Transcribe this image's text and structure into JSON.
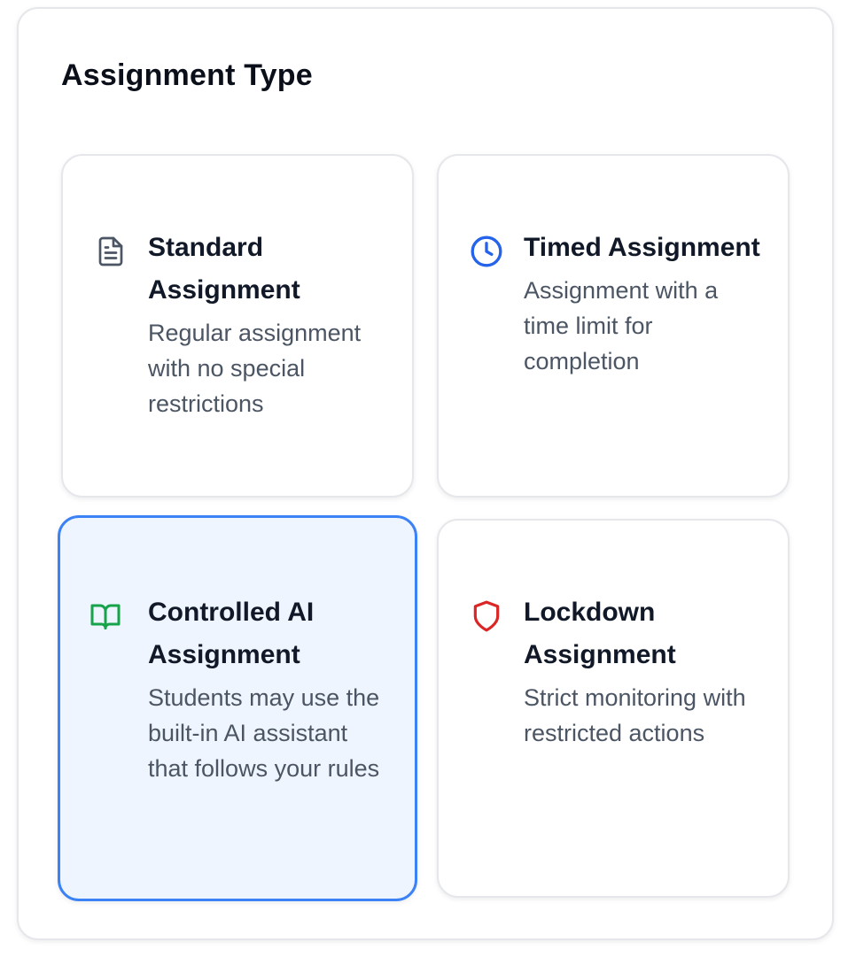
{
  "section": {
    "title": "Assignment Type"
  },
  "options": [
    {
      "title": "Standard Assignment",
      "description": "Regular assignment with no special restrictions",
      "icon": "document-icon",
      "icon_color": "#4b5563",
      "selected": false
    },
    {
      "title": "Timed Assignment",
      "description": "Assignment with a time limit for completion",
      "icon": "clock-icon",
      "icon_color": "#2563eb",
      "selected": false
    },
    {
      "title": "Controlled AI Assignment",
      "description": "Students may use the built-in AI assistant that follows your rules",
      "icon": "book-open-icon",
      "icon_color": "#16a34a",
      "selected": true
    },
    {
      "title": "Lockdown Assignment",
      "description": "Strict monitoring with restricted actions",
      "icon": "shield-icon",
      "icon_color": "#dc2626",
      "selected": false
    }
  ],
  "colors": {
    "selected_border": "#3b82f6",
    "selected_background": "#eef5fe"
  }
}
